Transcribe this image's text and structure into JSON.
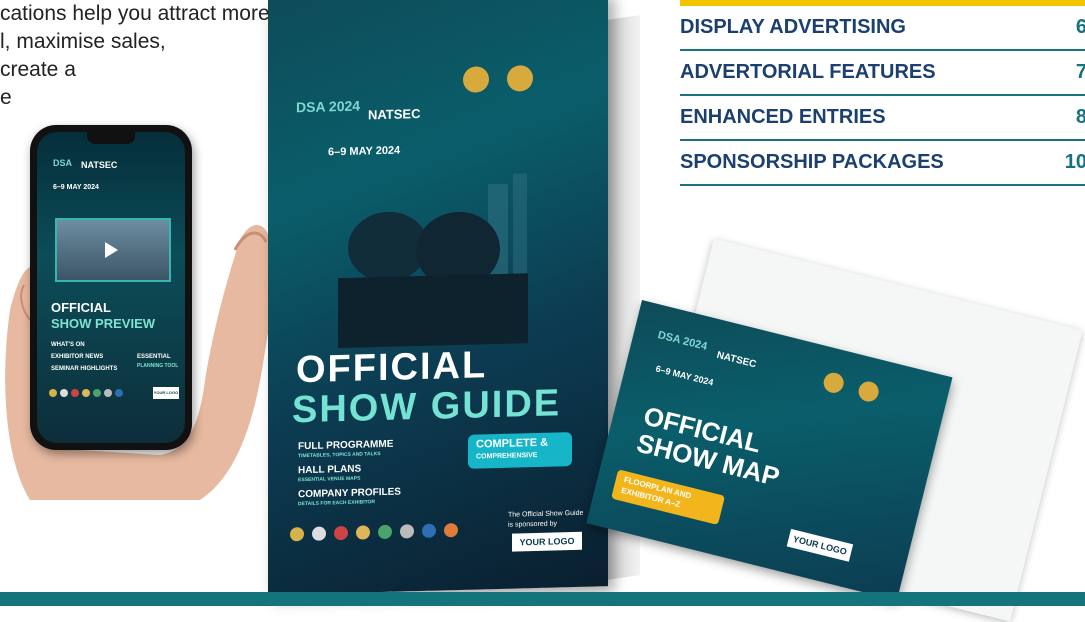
{
  "intro": {
    "lines": [
      "cations help you attract more",
      "l, maximise sales,",
      "create a",
      "e"
    ]
  },
  "toc": {
    "rows": [
      {
        "label": "DISPLAY ADVERTISING",
        "page": "6"
      },
      {
        "label": "ADVERTORIAL FEATURES",
        "page": "7"
      },
      {
        "label": "ENHANCED ENTRIES",
        "page": "8"
      },
      {
        "label": "SPONSORSHIP PACKAGES",
        "page": "10"
      }
    ]
  },
  "phone": {
    "brand": "NATSEC",
    "dates": "6–9 MAY 2024",
    "title_line1": "OFFICIAL",
    "title_line2": "SHOW PREVIEW",
    "items": [
      "WHAT'S ON",
      "EXHIBITOR NEWS",
      "SEMINAR HIGHLIGHTS"
    ],
    "badge_line1": "ESSENTIAL",
    "badge_line2": "PLANNING TOOL",
    "logo": "YOUR LOGO"
  },
  "book": {
    "event": "DSA 2024",
    "brand": "NATSEC",
    "dates": "6–9 MAY 2024",
    "title_line1": "OFFICIAL",
    "title_line2": "SHOW GUIDE",
    "features": [
      {
        "head": "FULL PROGRAMME",
        "sub": "TIMETABLES, TOPICS AND TALKS"
      },
      {
        "head": "HALL PLANS",
        "sub": "ESSENTIAL VENUE MAPS"
      },
      {
        "head": "COMPANY PROFILES",
        "sub": "DETAILS FOR EACH EXHIBITOR"
      }
    ],
    "badge_line1": "COMPLETE &",
    "badge_line2": "COMPREHENSIVE",
    "sponsor_line1": "The Official Show Guide",
    "sponsor_line2": "is sponsored by",
    "logo": "YOUR LOGO"
  },
  "map": {
    "event": "DSA 2024",
    "brand": "NATSEC",
    "dates": "6–9 MAY 2024",
    "title_line1": "OFFICIAL",
    "title_line2": "SHOW MAP",
    "ribbon_line1": "FLOORPLAN AND",
    "ribbon_line2": "EXHIBITOR A–Z",
    "logo": "YOUR LOGO"
  },
  "colors": {
    "accent": "#15737f",
    "heading": "#1b3f6f",
    "yellow": "#f2c400",
    "bar": "#13747c"
  }
}
